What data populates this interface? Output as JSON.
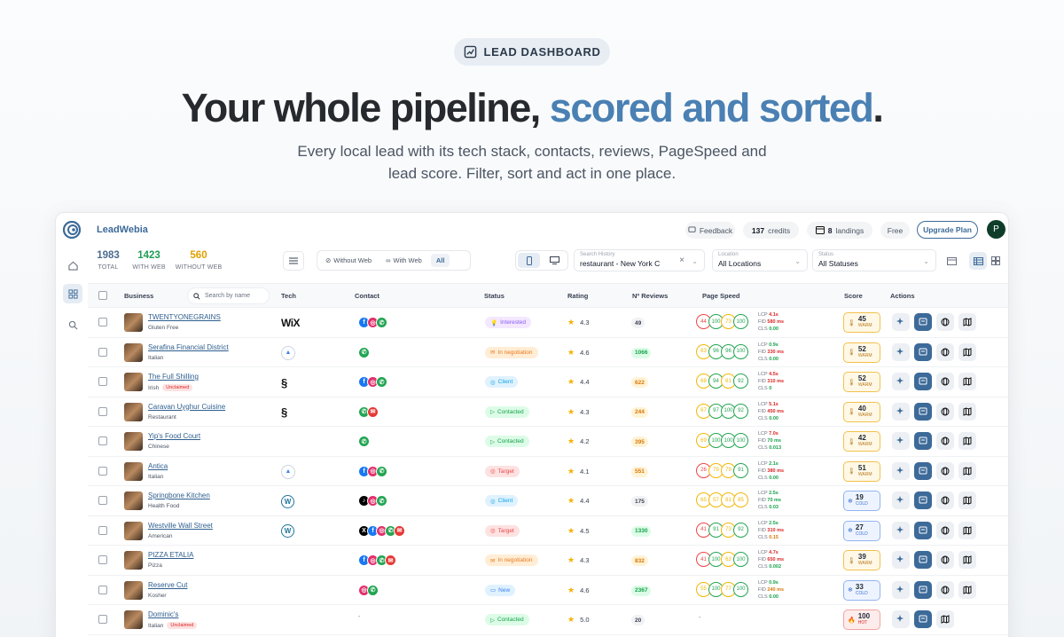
{
  "hero": {
    "badge": "LEAD DASHBOARD",
    "headline_plain": "Your whole pipeline, ",
    "headline_accent": "scored and sorted",
    "headline_end": ".",
    "sub_line1": "Every local lead with its tech stack, contacts, reviews, PageSpeed and",
    "sub_line2": "lead score. Filter, sort and act in one place."
  },
  "app": {
    "brand": "LeadWebia",
    "feedback": "Feedback",
    "credits_num": "137",
    "credits_label": "credits",
    "landings_num": "8",
    "landings_label": "landings",
    "plan": "Free",
    "upgrade": "Upgrade Plan",
    "avatar": "P"
  },
  "stats": [
    {
      "value": "1983",
      "label": "TOTAL",
      "color": "#4a6d8f"
    },
    {
      "value": "1423",
      "label": "WITH WEB",
      "color": "#1f9d55"
    },
    {
      "value": "560",
      "label": "WITHOUT WEB",
      "color": "#e0a100"
    }
  ],
  "filters": {
    "without_web": "Without Web",
    "with_web": "With Web",
    "all": "All",
    "search_label": "Search History",
    "search_value": "restaurant - New York C",
    "location_label": "Location",
    "location_value": "All Locations",
    "status_label": "Status",
    "status_value": "All Statuses"
  },
  "columns": {
    "business": "Business",
    "search_placeholder": "Search by name",
    "tech": "Tech",
    "contact": "Contact",
    "status": "Status",
    "rating": "Rating",
    "reviews": "Nº Reviews",
    "pagespeed": "Page Speed",
    "score": "Score",
    "actions": "Actions"
  },
  "rows": [
    {
      "name": "TWENTYONEGRAINS",
      "cat": "Gluten Free",
      "unclaimed": "",
      "tech": "wix",
      "contacts": [
        "fb",
        "ig",
        "ph"
      ],
      "status": "Interested",
      "rating": "4.3",
      "reviews": "49",
      "ps": [
        "44",
        "100",
        "73",
        "100"
      ],
      "lcp": "4.1s",
      "fid": "580 ms",
      "cls": "0.00",
      "score": "45",
      "level": "WARM"
    },
    {
      "name": "Serafina Financial District",
      "cat": "Italian",
      "unclaimed": "",
      "tech": "a",
      "contacts": [
        "ph"
      ],
      "status": "In negotiation",
      "rating": "4.6",
      "reviews": "1066",
      "ps": [
        "63",
        "96",
        "96",
        "100"
      ],
      "lcp": "0.9s",
      "fid": "330 ms",
      "cls": "0.00",
      "score": "52",
      "level": "WARM"
    },
    {
      "name": "The Full Shilling",
      "cat": "Irish",
      "unclaimed": "Unclaimed",
      "tech": "sq",
      "contacts": [
        "fb",
        "ig",
        "ph"
      ],
      "status": "Client",
      "rating": "4.4",
      "reviews": "622",
      "ps": [
        "68",
        "94",
        "81",
        "92"
      ],
      "lcp": "4.5s",
      "fid": "310 ms",
      "cls": "0",
      "score": "52",
      "level": "WARM"
    },
    {
      "name": "Caravan Uyghur Cuisine",
      "cat": "Restaurant",
      "unclaimed": "",
      "tech": "sq",
      "contacts": [
        "ph",
        "em"
      ],
      "status": "Contacted",
      "rating": "4.3",
      "reviews": "244",
      "ps": [
        "67",
        "97",
        "100",
        "92"
      ],
      "lcp": "5.1s",
      "fid": "450 ms",
      "cls": "0.00",
      "score": "40",
      "level": "WARM"
    },
    {
      "name": "Yip's Food Court",
      "cat": "Chinese",
      "unclaimed": "",
      "tech": "",
      "contacts": [
        "ph"
      ],
      "status": "Contacted",
      "rating": "4.2",
      "reviews": "395",
      "ps": [
        "69",
        "100",
        "100",
        "100"
      ],
      "lcp": "7.0s",
      "fid": "70 ms",
      "cls": "0.013",
      "score": "42",
      "level": "WARM"
    },
    {
      "name": "Antica",
      "cat": "Italian",
      "unclaimed": "",
      "tech": "a",
      "contacts": [
        "fb",
        "ig",
        "ph"
      ],
      "status": "Target",
      "rating": "4.1",
      "reviews": "551",
      "ps": [
        "26",
        "79",
        "79",
        "91"
      ],
      "lcp": "2.1s",
      "fid": "380 ms",
      "cls": "0.00",
      "score": "51",
      "level": "WARM"
    },
    {
      "name": "Springbone Kitchen",
      "cat": "Health Food",
      "unclaimed": "",
      "tech": "wp",
      "contacts": [
        "tt",
        "ig",
        "ph"
      ],
      "status": "Client",
      "rating": "4.4",
      "reviews": "175",
      "ps": [
        "65",
        "57",
        "81",
        "85"
      ],
      "lcp": "2.5s",
      "fid": "70 ms",
      "cls": "0.03",
      "score": "19",
      "level": "COLD"
    },
    {
      "name": "Westville Wall Street",
      "cat": "American",
      "unclaimed": "",
      "tech": "wp",
      "contacts": [
        "x",
        "fb",
        "ig",
        "ph",
        "em"
      ],
      "status": "Target",
      "rating": "4.5",
      "reviews": "1330",
      "ps": [
        "41",
        "91",
        "73",
        "92"
      ],
      "lcp": "2.5s",
      "fid": "310 ms",
      "cls": "0.15",
      "score": "27",
      "level": "COLD"
    },
    {
      "name": "PIZZA ETALIA",
      "cat": "Pizza",
      "unclaimed": "",
      "tech": "",
      "contacts": [
        "fb",
        "ig",
        "ph",
        "em"
      ],
      "status": "In negotiation",
      "rating": "4.3",
      "reviews": "832",
      "ps": [
        "41",
        "100",
        "63",
        "100"
      ],
      "lcp": "4.7s",
      "fid": "650 ms",
      "cls": "0.002",
      "score": "39",
      "level": "WARM"
    },
    {
      "name": "Reserve Cut",
      "cat": "Kosher",
      "unclaimed": "",
      "tech": "",
      "contacts": [
        "ig",
        "ph"
      ],
      "status": "New",
      "rating": "4.6",
      "reviews": "2367",
      "ps": [
        "55",
        "100",
        "77",
        "100"
      ],
      "lcp": "0.9s",
      "fid": "240 ms",
      "cls": "0.00",
      "score": "33",
      "level": "COLD"
    },
    {
      "name": "Dominic's",
      "cat": "Italian",
      "unclaimed": "Unclaimed",
      "tech": "",
      "contacts": [],
      "contact_text": "-",
      "status": "Contacted",
      "rating": "5.0",
      "reviews": "20",
      "ps": [],
      "ps_text": "-",
      "lcp": "",
      "fid": "",
      "cls": "",
      "score": "100",
      "level": "HOT"
    }
  ],
  "metric_labels": {
    "lcp": "LCP",
    "fid": "FID",
    "cls": "CLS"
  }
}
